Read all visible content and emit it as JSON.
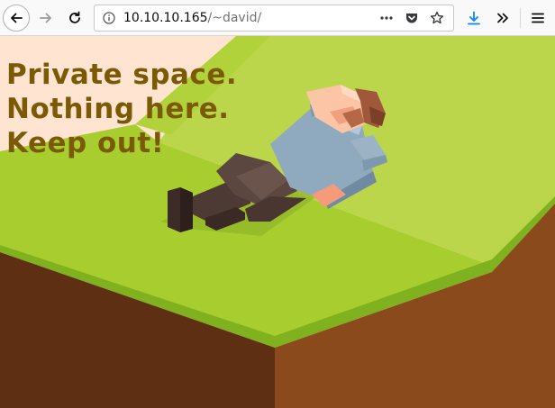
{
  "browser": {
    "url_host": "10.10.10.165",
    "url_path": "/~david/",
    "page_actions_icon": "more-horizontal-icon",
    "pocket_icon": "pocket-icon",
    "bookmark_icon": "star-icon",
    "download_icon": "download-arrow-icon",
    "overflow_icon": "double-chevron-icon",
    "menu_icon": "hamburger-menu-icon"
  },
  "page": {
    "headline_lines": [
      "Private space.",
      "Nothing here.",
      "Keep out!"
    ],
    "text_color": "#7a5a05",
    "illustration": "person-lying-on-grassy-cliff"
  },
  "colors": {
    "background_peach": "#ffe5d1",
    "grass_light": "#b8d44a",
    "grass": "#a6cc2c",
    "dirt_left": "#5e2f12",
    "dirt_right": "#8a4a1c",
    "accent_blue": "#0a84ff"
  }
}
